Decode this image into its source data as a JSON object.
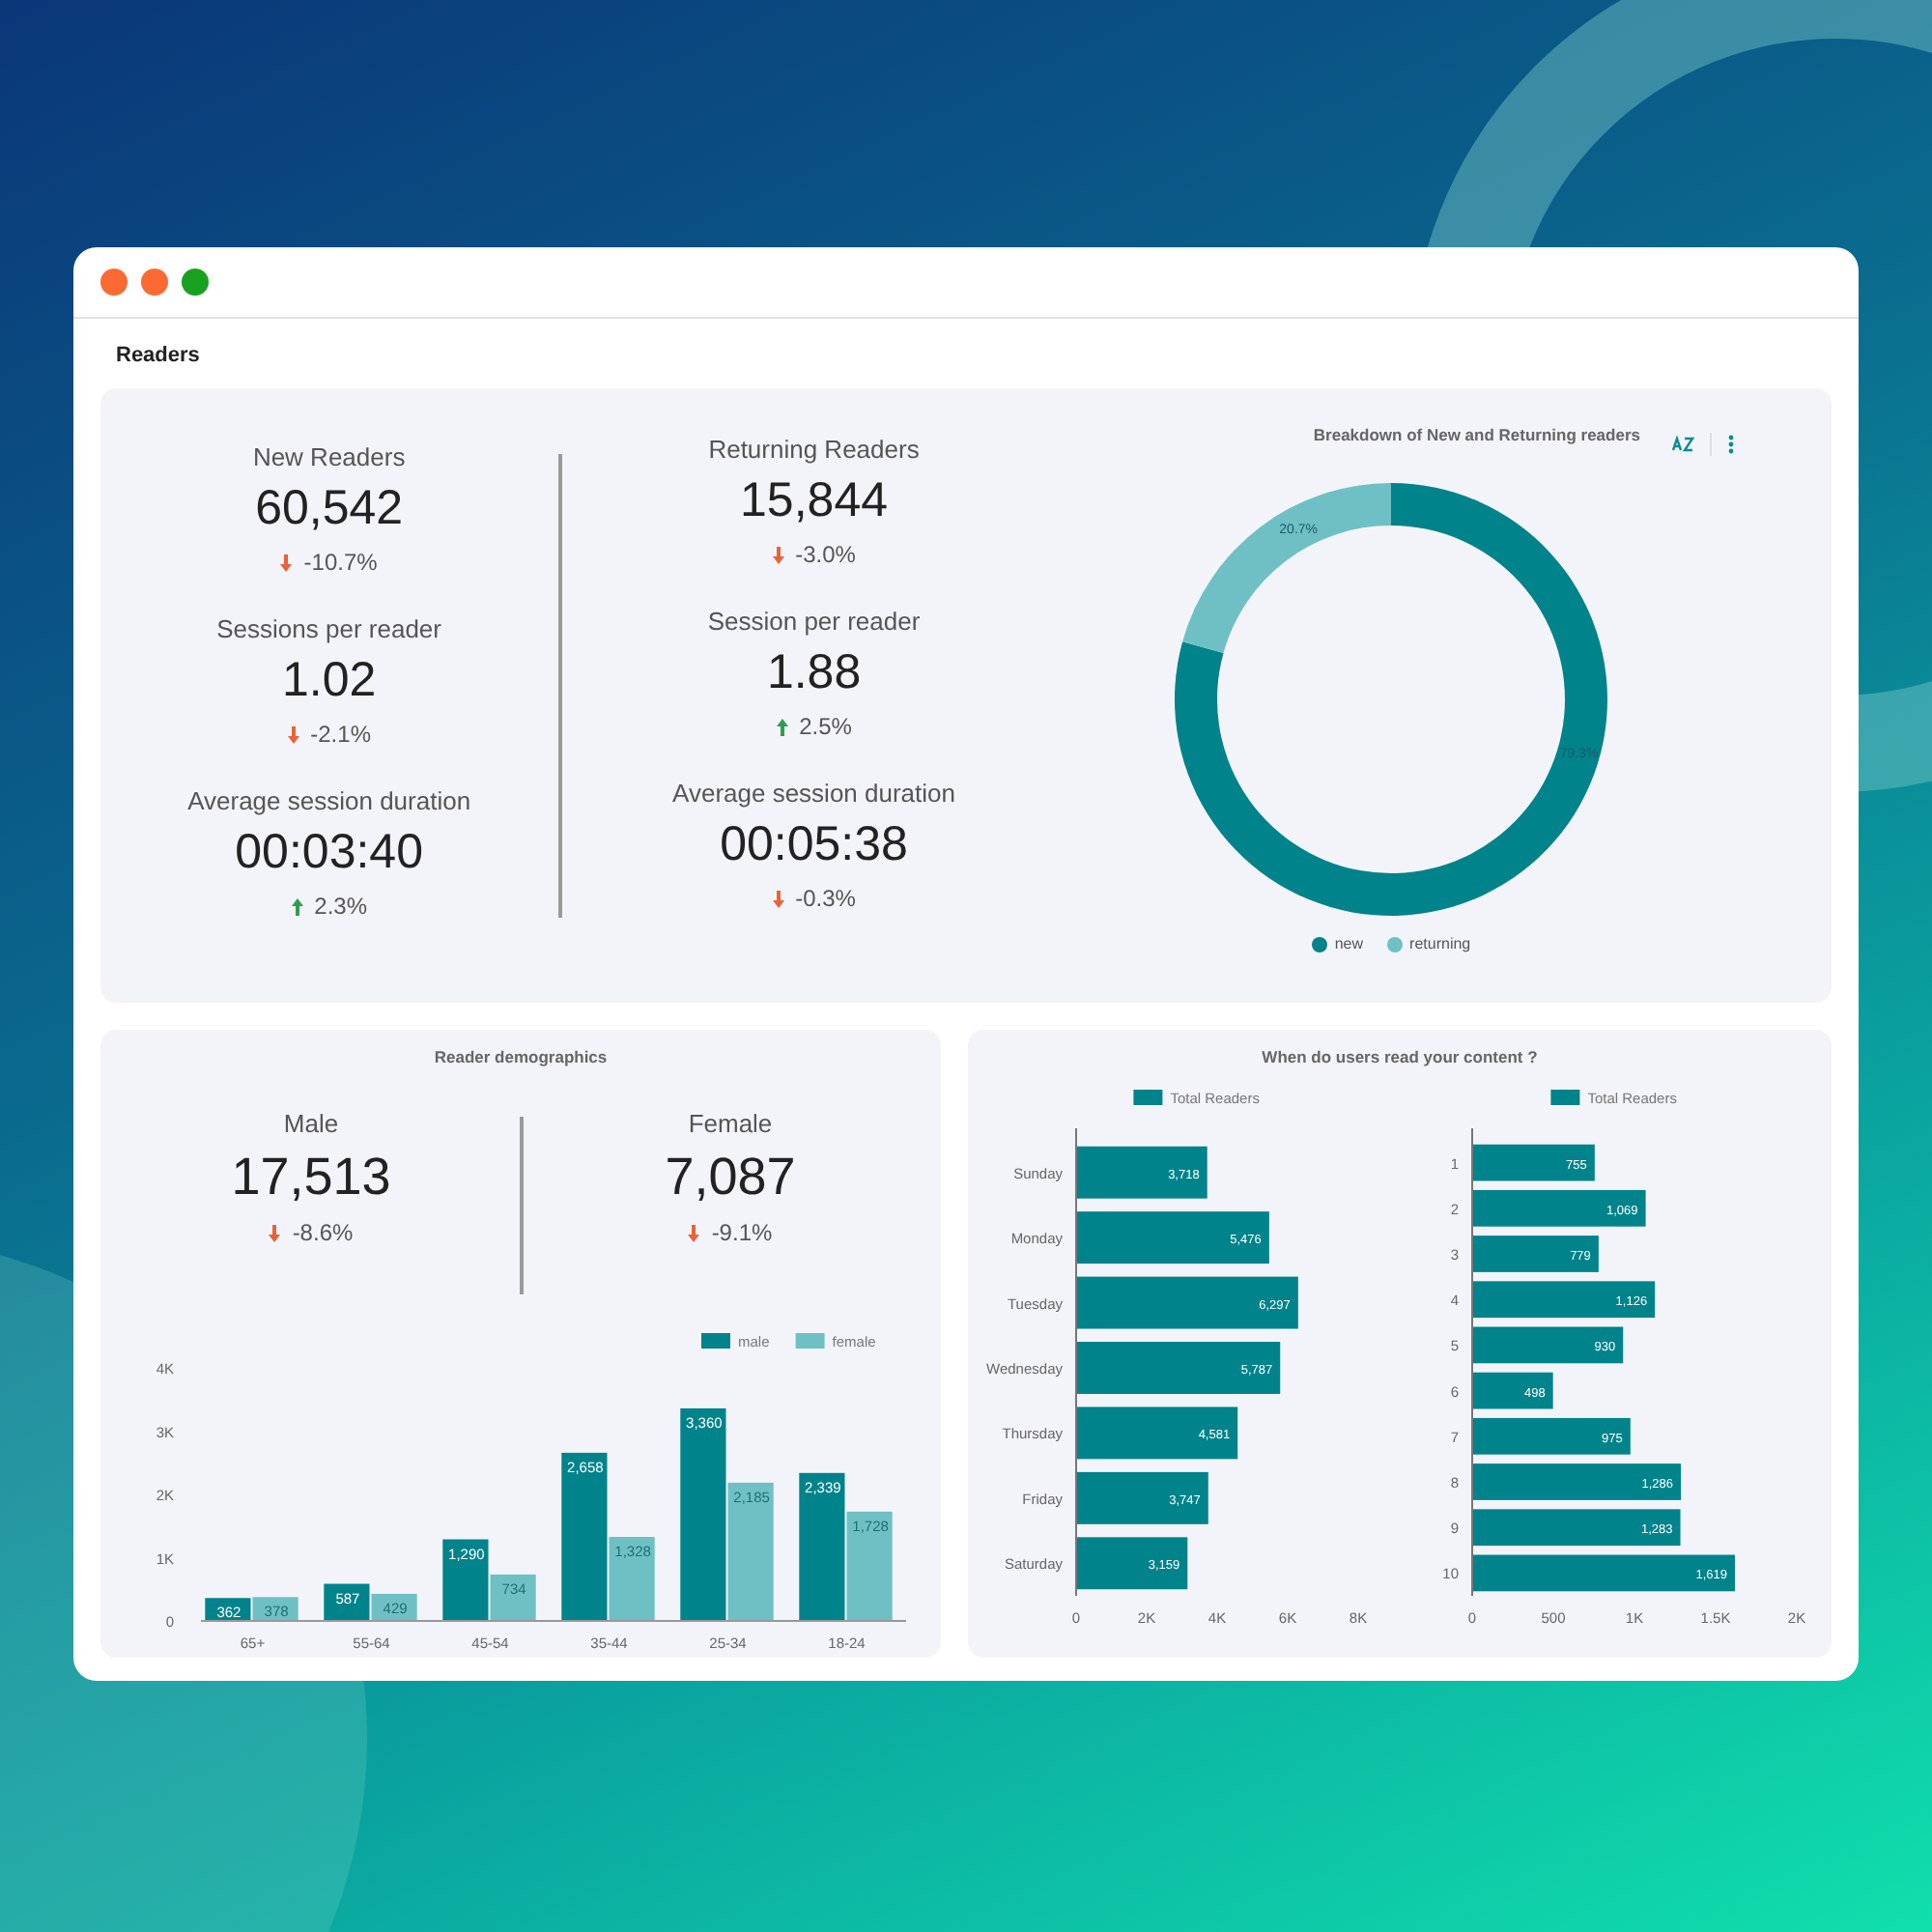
{
  "window": {
    "title": "Readers"
  },
  "overview": {
    "kpis": [
      {
        "label": "New Readers",
        "value": "60,542",
        "change": "-10.7%",
        "increase": false
      },
      {
        "label": "Returning Readers",
        "value": "15,844",
        "change": "-3.0%",
        "increase": false
      },
      {
        "label": "Sessions per reader",
        "value": "1.02",
        "change": "-2.1%",
        "increase": false
      },
      {
        "label": "Session per reader",
        "value": "1.88",
        "change": "2.5%",
        "increase": true
      },
      {
        "label": "Average session duration",
        "value": "00:03:40",
        "change": "2.3%",
        "increase": true
      },
      {
        "label": "Average session duration",
        "value": "00:05:38",
        "change": "-0.3%",
        "increase": false
      }
    ],
    "chart_data": {
      "type": "donut",
      "title": "Breakdown of New and Returning readers",
      "categories": [
        "new",
        "returning"
      ],
      "values": [
        79.3,
        20.7
      ],
      "value_labels": [
        "79.3%",
        "20.7%"
      ],
      "colors": [
        "#00838a",
        "#6fc0c4"
      ],
      "legend": "bottom"
    }
  },
  "demographics": {
    "title": "Reader demographics",
    "kpis": [
      {
        "label": "Male",
        "value": "17,513",
        "change": "-8.6%",
        "increase": false
      },
      {
        "label": "Female",
        "value": "7,087",
        "change": "-9.1%",
        "increase": false
      }
    ],
    "chart_data": {
      "type": "bar",
      "orientation": "vertical",
      "legend": "top-right",
      "categories": [
        "65+",
        "55-64",
        "45-54",
        "35-44",
        "25-34",
        "18-24"
      ],
      "series": [
        {
          "name": "male",
          "color": "#00838a",
          "values": [
            362,
            587,
            1290,
            2658,
            3360,
            2339
          ],
          "value_labels": [
            "362",
            "587",
            "1,290",
            "2,658",
            "3,360",
            "2,339"
          ]
        },
        {
          "name": "female",
          "color": "#6fc0c4",
          "values": [
            378,
            429,
            734,
            1328,
            2185,
            1728
          ],
          "value_labels": [
            "378",
            "429",
            "734",
            "1,328",
            "2,185",
            "1,728"
          ]
        }
      ],
      "ylim": [
        0,
        4000
      ],
      "yticks": [
        {
          "value": 0,
          "label": "0"
        },
        {
          "value": 1000,
          "label": "1K"
        },
        {
          "value": 2000,
          "label": "2K"
        },
        {
          "value": 3000,
          "label": "3K"
        },
        {
          "value": 4000,
          "label": "4K"
        }
      ]
    }
  },
  "reading_times": {
    "title": "When do users read your content ?",
    "charts": [
      {
        "chart_data": {
          "type": "bar",
          "orientation": "horizontal",
          "legend": "top",
          "categories": [
            "Sunday",
            "Monday",
            "Tuesday",
            "Wednesday",
            "Thursday",
            "Friday",
            "Saturday"
          ],
          "series": [
            {
              "name": "Total Readers",
              "color": "#00838a",
              "values": [
                3718,
                5476,
                6297,
                5787,
                4581,
                3747,
                3159
              ],
              "value_labels": [
                "3,718",
                "5,476",
                "6,297",
                "5,787",
                "4,581",
                "3,747",
                "3,159"
              ]
            }
          ],
          "xlim": [
            0,
            8000
          ],
          "xticks": [
            {
              "value": 0,
              "label": "0"
            },
            {
              "value": 2000,
              "label": "2K"
            },
            {
              "value": 4000,
              "label": "4K"
            },
            {
              "value": 6000,
              "label": "6K"
            },
            {
              "value": 8000,
              "label": "8K"
            }
          ]
        }
      },
      {
        "chart_data": {
          "type": "bar",
          "orientation": "horizontal",
          "legend": "top",
          "categories": [
            "1",
            "2",
            "3",
            "4",
            "5",
            "6",
            "7",
            "8",
            "9",
            "10"
          ],
          "series": [
            {
              "name": "Total Readers",
              "color": "#00838a",
              "values": [
                755,
                1069,
                779,
                1126,
                930,
                498,
                975,
                1286,
                1283,
                1619
              ],
              "value_labels": [
                "755",
                "1,069",
                "779",
                "1,126",
                "930",
                "498",
                "975",
                "1,286",
                "1,283",
                "1,619"
              ]
            }
          ],
          "xlim": [
            0,
            2000
          ],
          "xticks": [
            {
              "value": 0,
              "label": "0"
            },
            {
              "value": 500,
              "label": "500"
            },
            {
              "value": 1000,
              "label": "1K"
            },
            {
              "value": 1500,
              "label": "1.5K"
            },
            {
              "value": 2000,
              "label": "2K"
            }
          ]
        }
      }
    ]
  }
}
